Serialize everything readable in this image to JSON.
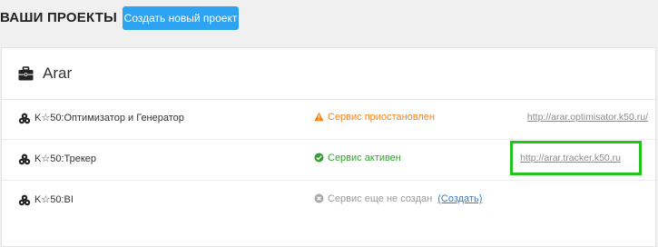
{
  "header": {
    "title": "ВАШИ ПРОЕКТЫ",
    "create_button": "Создать новый проект"
  },
  "project": {
    "name": "Arar",
    "icon": "briefcase-icon"
  },
  "services": [
    {
      "name": "K☆50:Оптимизатор и Генератор",
      "status": "Сервис приостановлен",
      "status_icon": "warning-icon",
      "status_color": "#f0831e",
      "url": "http://arar.optimisator.k50.ru/"
    },
    {
      "name": "K☆50:Трекер",
      "status": "Сервис активен",
      "status_icon": "check-circle-icon",
      "status_color": "#34a031",
      "url": "http://arar.tracker.k50.ru",
      "highlighted": true,
      "highlight_color": "#22c21f"
    },
    {
      "name": "K☆50:BI",
      "status": "Сервис еще не создан",
      "status_icon": "x-circle-icon",
      "status_color": "#9a9a9a",
      "action_link": "(Создать)"
    }
  ],
  "colors": {
    "accent": "#2ea3f2",
    "link": "#3a7dc4",
    "background": "#f0f0f0",
    "panel": "#ffffff"
  }
}
